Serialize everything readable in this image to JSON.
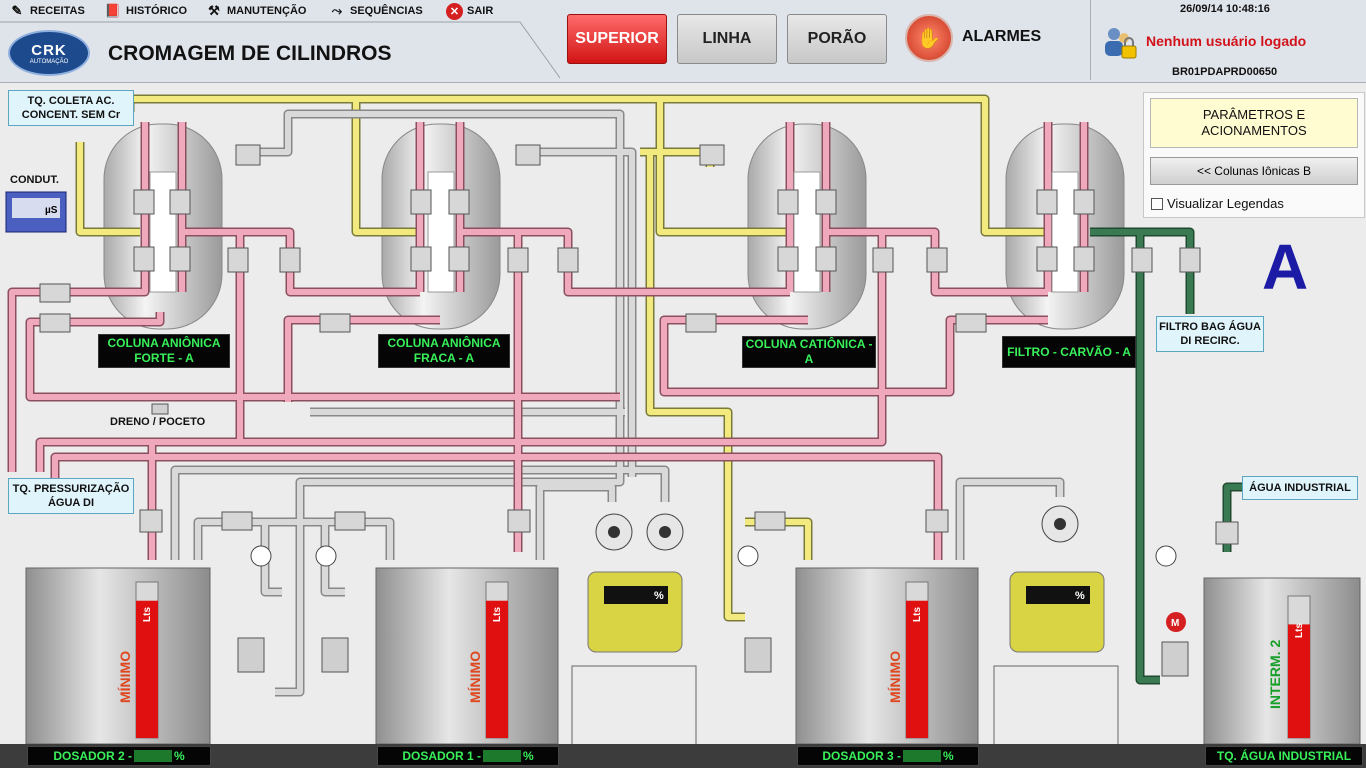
{
  "menu": [
    {
      "label": "RECEITAS",
      "icon": "pencil-icon"
    },
    {
      "label": "HISTÓRICO",
      "icon": "book-icon"
    },
    {
      "label": "MANUTENÇÃO",
      "icon": "tools-icon"
    },
    {
      "label": "SEQUÊNCIAS",
      "icon": "sequence-icon"
    },
    {
      "label": "SAIR",
      "icon": "close-icon"
    }
  ],
  "logo": {
    "text": "CRK",
    "subtext": "AUTOMAÇÃO"
  },
  "app_title": "CROMAGEM DE CILINDROS",
  "nav": {
    "superior": "SUPERIOR",
    "linha": "LINHA",
    "porao": "PORÃO"
  },
  "alarms_label": "ALARMES",
  "datetime": "26/09/14 10:48:16",
  "user_status": "Nenhum usuário logado",
  "station": "BR01PDAPRD00650",
  "side": {
    "params_label": "PARÂMETROS E ACIONAMENTOS",
    "columns_button": "<<    Colunas Iônicas B",
    "legend_checkbox": "Visualizar Legendas",
    "group_letter": "A"
  },
  "tags": {
    "tq_coleta": "TQ. COLETA AC. CONCENT. SEM Cr",
    "condut": "CONDUT.",
    "condut_unit": "µS",
    "filtro_bag": "FILTRO BAG ÁGUA DI RECIRC.",
    "dreno": "DRENO / POCETO",
    "tq_press": "TQ. PRESSURIZAÇÃO ÁGUA DI",
    "agua_industrial": "ÁGUA INDUSTRIAL"
  },
  "columns": [
    {
      "label": "COLUNA ANIÔNICA FORTE - A"
    },
    {
      "label": "COLUNA ANIÔNICA FRACA - A"
    },
    {
      "label": "COLUNA CATIÔNICA - A"
    },
    {
      "label": "FILTRO - CARVÃO - A"
    }
  ],
  "tanks": [
    {
      "side": "MÍNIMO",
      "side_color": "#e0461e",
      "level_pct": 88,
      "name": "DOSADOR 2 - ",
      "unit": "%"
    },
    {
      "side": "MÍNIMO",
      "side_color": "#e0461e",
      "level_pct": 88,
      "name": "DOSADOR 1 - ",
      "unit": "%"
    },
    {
      "side": "MÍNIMO",
      "side_color": "#e0461e",
      "level_pct": 88,
      "name": "DOSADOR 3 - ",
      "unit": "%"
    },
    {
      "side": "INTERM. 2",
      "side_color": "#18a02a",
      "level_pct": 80,
      "name": "TQ. ÁGUA INDUSTRIAL",
      "unit": ""
    }
  ],
  "gauge_unit": "%",
  "level_unit": "Lts",
  "motor_label": "M",
  "colors": {
    "pink": "#e8a0b4",
    "yellow": "#f2ea7e",
    "gray": "#cfcfcf",
    "green": "#3a7a52",
    "red_bar": "#e01010"
  }
}
